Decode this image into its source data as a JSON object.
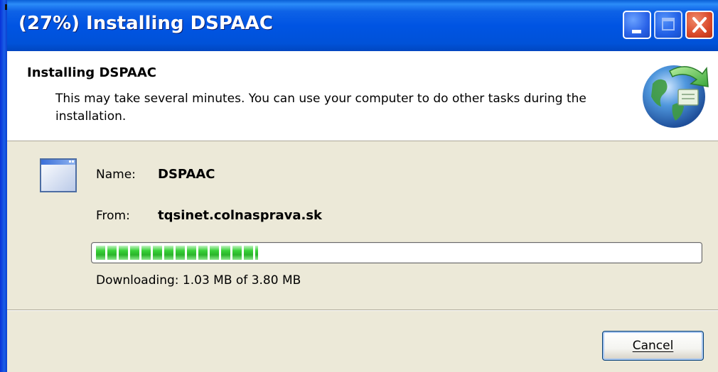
{
  "window": {
    "title": "(27%) Installing DSPAAC"
  },
  "caption_buttons": {
    "minimize_icon": "minimize-icon",
    "maximize_icon": "maximize-icon",
    "close_icon": "close-icon"
  },
  "header": {
    "title": "Installing DSPAAC",
    "description": "This may take several minutes. You can use your computer to do other tasks during the installation.",
    "icon": "globe-install-icon"
  },
  "details": {
    "app_icon": "application-window-icon",
    "name_label": "Name:",
    "name_value": "DSPAAC",
    "from_label": "From:",
    "from_value": "tqsinet.colnasprava.sk"
  },
  "progress": {
    "fraction": 0.27,
    "status": "Downloading: 1.03 MB of 3.80 MB"
  },
  "buttons": {
    "cancel_label": "Cancel"
  },
  "colors": {
    "titlebar": "#0054e3",
    "dialog_background": "#ece9d8",
    "progress_fill": "#2ab42a",
    "close_button": "#d9492a"
  }
}
